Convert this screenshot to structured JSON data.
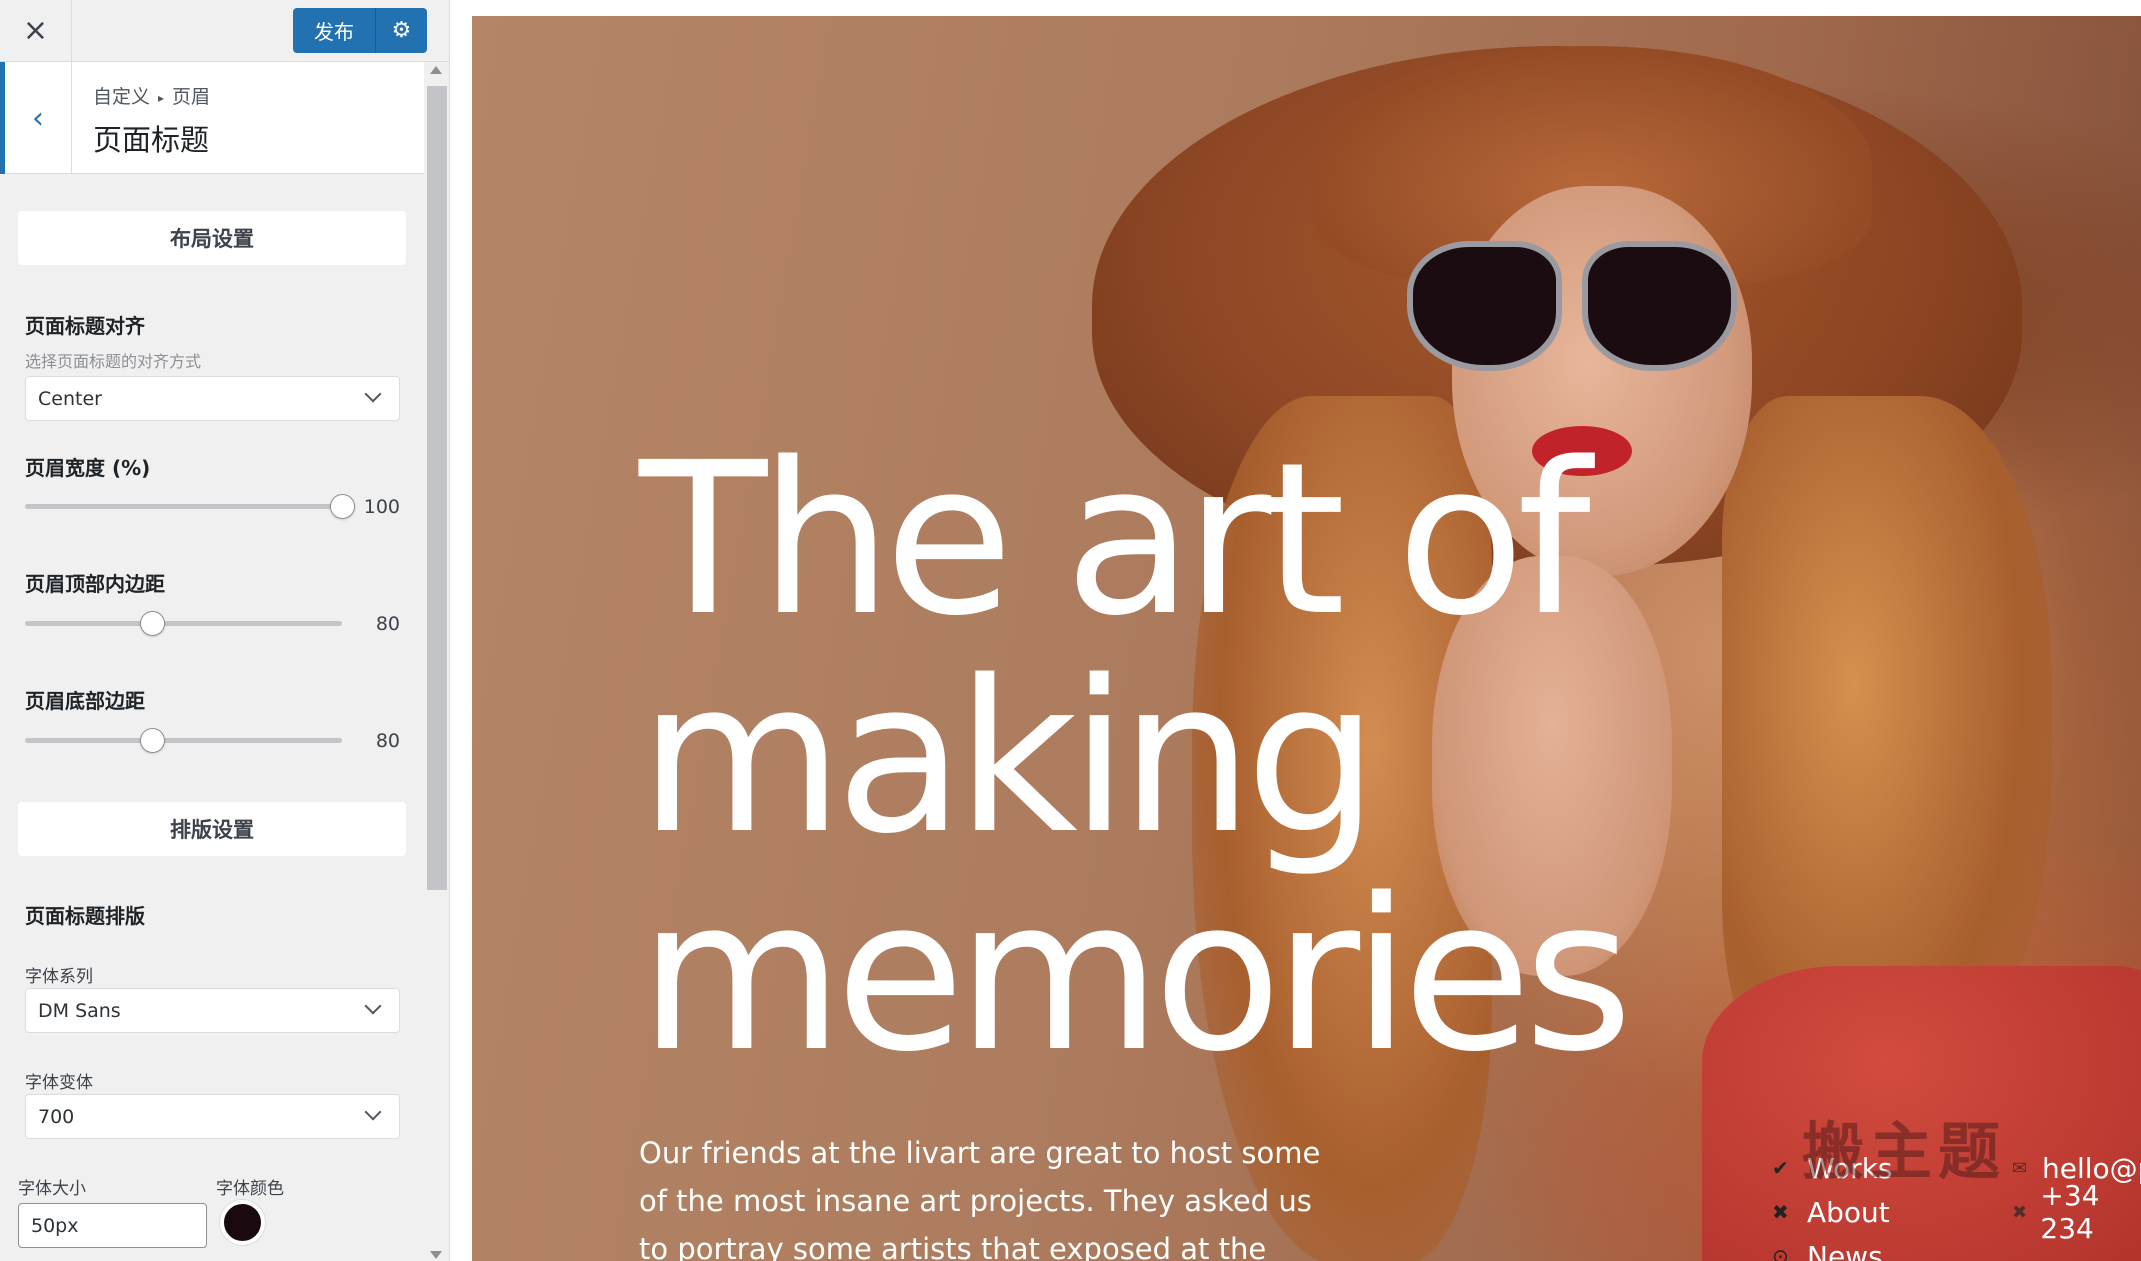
{
  "topbar": {
    "close_icon": "×",
    "publish_label": "发布",
    "gear_icon": "⚙"
  },
  "section": {
    "breadcrumb_root": "自定义",
    "breadcrumb_sep": "▸",
    "breadcrumb_parent": "页眉",
    "title": "页面标题",
    "back_icon": "‹"
  },
  "layout_group": {
    "label": "布局设置"
  },
  "alignment": {
    "label": "页面标题对齐",
    "description": "选择页面标题的对齐方式",
    "value": "Center"
  },
  "header_width": {
    "label": "页眉宽度 (%)",
    "value": "100",
    "fraction": 1.0
  },
  "top_padding": {
    "label": "页眉顶部内边距",
    "value": "80",
    "fraction": 0.4
  },
  "bottom_padding": {
    "label": "页眉底部边距",
    "value": "80",
    "fraction": 0.4
  },
  "typography_group": {
    "label": "排版设置"
  },
  "typography": {
    "heading": "页面标题排版",
    "font_family_label": "字体系列",
    "font_family_value": "DM Sans",
    "font_variant_label": "字体变体",
    "font_variant_value": "700",
    "font_size_label": "字体大小",
    "font_size_value": "50px",
    "font_color_label": "字体颜色",
    "font_color": "#1a0a0f"
  },
  "preview": {
    "title_line1": "The art of",
    "title_line2": "making",
    "title_line3": "memories",
    "intro": "Our friends at the livart are great to host some of the most insane art projects. They asked us to portray some artists that exposed at the gallery.",
    "nav": [
      {
        "icon": "check-icon",
        "glyph": "✔",
        "label": "Works"
      },
      {
        "icon": "close-icon",
        "glyph": "✖",
        "label": "About"
      },
      {
        "icon": "target-icon",
        "glyph": "⊙",
        "label": "News"
      }
    ],
    "contact": [
      {
        "glyph": "✉",
        "label": "hello@p"
      },
      {
        "glyph": "✖",
        "label": "+34 234"
      }
    ],
    "watermark": "搬主题"
  },
  "colors": {
    "accent": "#2271b1",
    "panel_bg": "#f0f0f1"
  }
}
